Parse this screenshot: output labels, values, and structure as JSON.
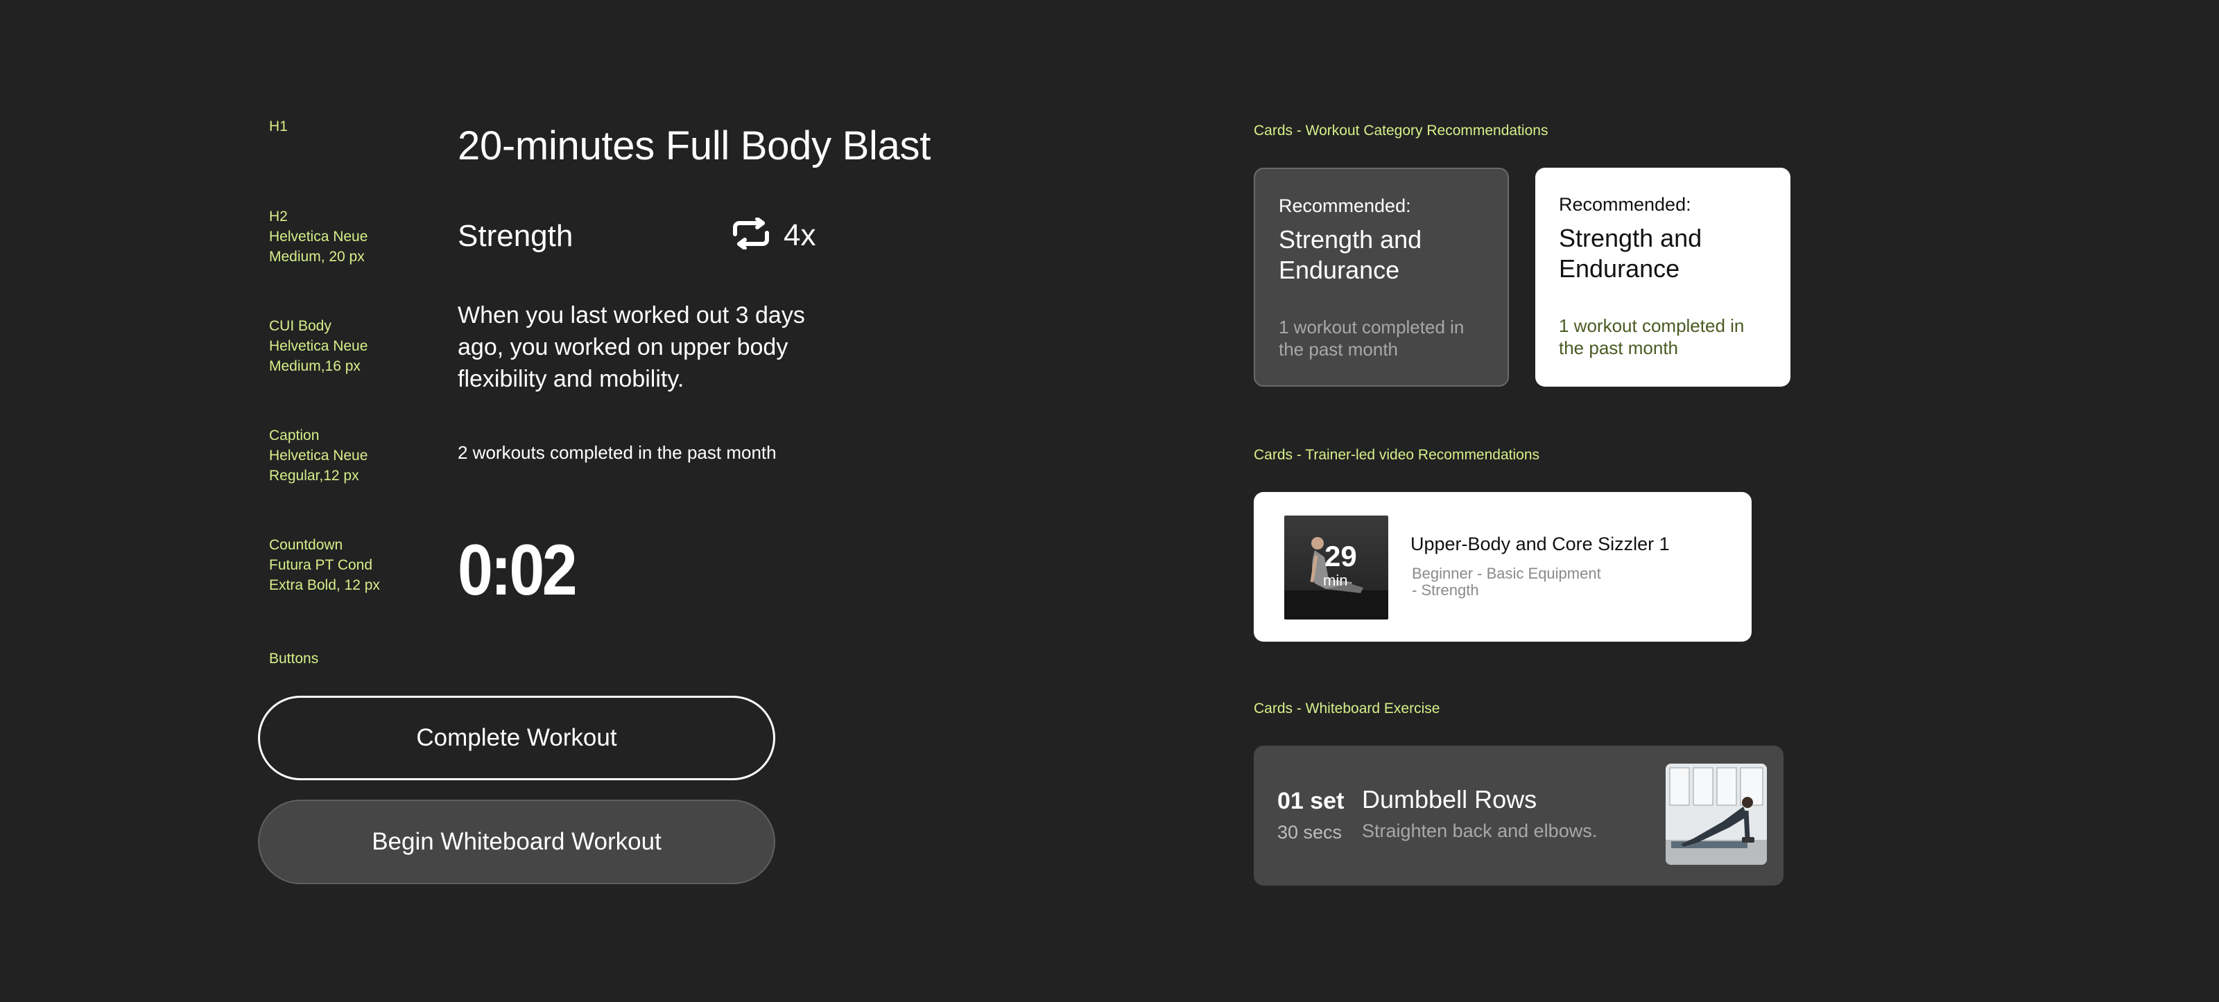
{
  "spec_labels": {
    "h1": "H1",
    "h2": "H2\nHelvetica Neue\nMedium, 20 px",
    "body": "CUI Body\nHelvetica Neue\nMedium,16 px",
    "caption": "Caption\nHelvetica Neue\nRegular,12 px",
    "countdown": "Countdown\nFutura PT Cond\nExtra Bold, 12 px",
    "buttons": "Buttons"
  },
  "samples": {
    "h1": "20-minutes Full Body Blast",
    "h2": "Strength",
    "repeat_count": "4x",
    "body": "When you last worked out 3 days ago, you worked on upper body flexibility and mobility.",
    "caption": "2 workouts completed in the past month",
    "countdown": "0:02"
  },
  "buttons": {
    "complete": "Complete Workout",
    "begin": "Begin Whiteboard Workout"
  },
  "sections": {
    "category": "Cards - Workout Category Recommendations",
    "trainer": "Cards - Trainer-led video Recommendations",
    "whiteboard": "Cards - Whiteboard Exercise"
  },
  "rec_cards": [
    {
      "kicker": "Recommended:",
      "title": "Strength and Endurance",
      "subtitle": "1 workout completed in the past month"
    },
    {
      "kicker": "Recommended:",
      "title": "Strength and Endurance",
      "subtitle": "1 workout completed in the past month"
    }
  ],
  "video_card": {
    "duration_value": "29",
    "duration_unit": "min",
    "title": "Upper-Body and Core Sizzler 1",
    "meta": "Beginner  - Basic Equipment\n- Strength"
  },
  "whiteboard_card": {
    "sets": "01 set",
    "time": "30 secs",
    "title": "Dumbbell Rows",
    "description": "Straighten back and elbows."
  },
  "colors": {
    "background": "#222222",
    "accent_label": "#d8ef8a",
    "card_dark": "#474747",
    "card_light": "#ffffff"
  },
  "icons": {
    "repeat": "repeat-icon"
  }
}
